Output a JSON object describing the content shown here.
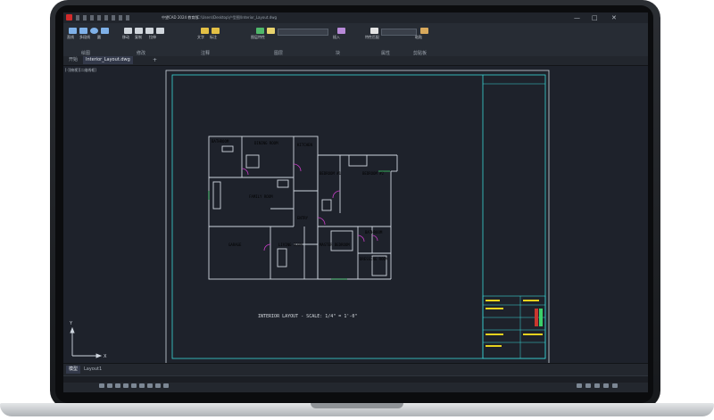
{
  "app": {
    "title_bar_text": "中望CAD 2024 教育版",
    "file_path": "C:\\Users\\Desktop\\户型图\\Interior_Layout.dwg"
  },
  "ribbon": {
    "groups": [
      {
        "label": "绘图"
      },
      {
        "label": "修改"
      },
      {
        "label": "注释"
      },
      {
        "label": "图层"
      },
      {
        "label": "块"
      },
      {
        "label": "属性"
      },
      {
        "label": "剪贴板"
      }
    ],
    "tool_labels": [
      "直线",
      "多段线",
      "圆",
      "移动",
      "复制",
      "拉伸",
      "文字",
      "标注",
      "图层特性",
      "插入",
      "特性匹配",
      "粘贴"
    ]
  },
  "document_tabs": [
    {
      "label": "开始"
    },
    {
      "label": "Interior_Layout.dwg",
      "active": true
    }
  ],
  "drawing": {
    "caption": "INTERIOR LAYOUT - SCALE: 1/4\" = 1'-0\"",
    "rooms": [
      {
        "label": "BATHROOM"
      },
      {
        "label": "DINING ROOM"
      },
      {
        "label": "KITCHEN"
      },
      {
        "label": "FAMILY ROOM"
      },
      {
        "label": "BEDROOM #1"
      },
      {
        "label": "BEDROOM #2"
      },
      {
        "label": "GARAGE"
      },
      {
        "label": "LIVING ROOM"
      },
      {
        "label": "MASTER BEDROOM"
      },
      {
        "label": "BATHROOM"
      },
      {
        "label": "DRESSING ROOM"
      },
      {
        "label": "ENTRY"
      }
    ],
    "ucs_labels": {
      "y": "Y",
      "x": "X"
    }
  },
  "layout_tabs": [
    {
      "label": "模型",
      "active": true
    },
    {
      "label": "Layout1"
    }
  ],
  "colors": {
    "frame": "#3ad6d6",
    "walls": "#cfd6df",
    "door": "#c83ec8",
    "accent_green": "#3bd06a",
    "title_yellow": "#e6d21e"
  }
}
